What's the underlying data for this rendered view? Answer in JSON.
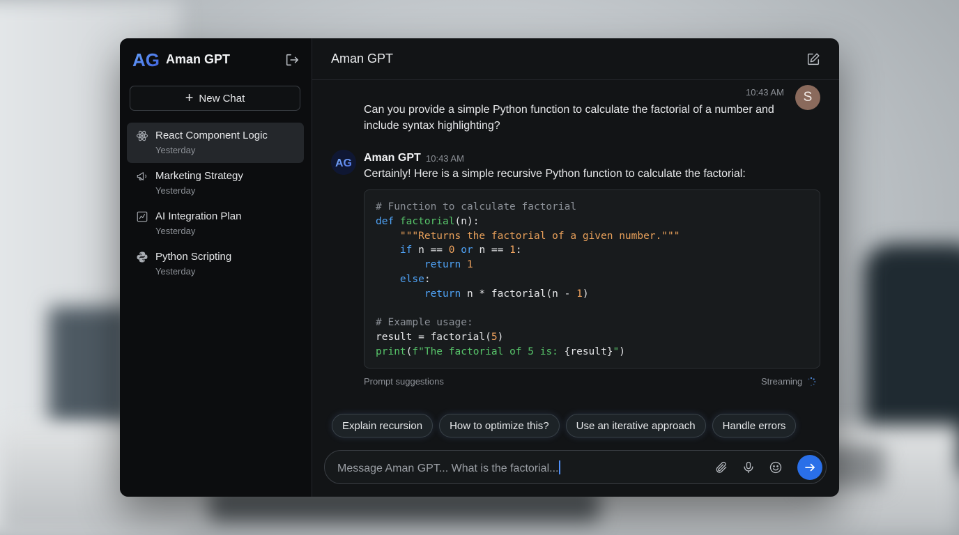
{
  "app": {
    "name": "Aman GPT",
    "logo_text": "AG",
    "accent": "#2a6fe8"
  },
  "sidebar": {
    "new_chat_label": "New Chat",
    "items": [
      {
        "title": "React Component Logic",
        "subtitle": "Yesterday",
        "icon": "atom-icon",
        "active": true
      },
      {
        "title": "Marketing Strategy",
        "subtitle": "Yesterday",
        "icon": "megaphone-icon",
        "active": false
      },
      {
        "title": "AI Integration Plan",
        "subtitle": "Yesterday",
        "icon": "chart-icon",
        "active": false
      },
      {
        "title": "Python Scripting",
        "subtitle": "Yesterday",
        "icon": "python-icon",
        "active": false
      }
    ]
  },
  "header": {
    "title": "Aman GPT"
  },
  "conversation": {
    "user": {
      "avatar_initial": "S",
      "time": "10:43 AM",
      "text": "Can you provide a simple Python function to calculate the factorial of a number and include syntax highlighting?"
    },
    "assistant": {
      "name": "Aman GPT",
      "time": "10:43 AM",
      "text": "Certainly! Here is a simple recursive Python function to calculate the factorial:",
      "code_lines": [
        [
          {
            "t": "# Function to calculate factorial",
            "c": "comment"
          }
        ],
        [
          {
            "t": "def ",
            "c": "kw"
          },
          {
            "t": "factorial",
            "c": "fn"
          },
          {
            "t": "(n):",
            "c": "plain"
          }
        ],
        [
          {
            "t": "    ",
            "c": "plain"
          },
          {
            "t": "\"\"\"Returns the factorial of a given number.\"\"\"",
            "c": "str"
          }
        ],
        [
          {
            "t": "    ",
            "c": "plain"
          },
          {
            "t": "if",
            "c": "kw"
          },
          {
            "t": " n == ",
            "c": "plain"
          },
          {
            "t": "0",
            "c": "num"
          },
          {
            "t": " ",
            "c": "plain"
          },
          {
            "t": "or",
            "c": "kw"
          },
          {
            "t": " n == ",
            "c": "plain"
          },
          {
            "t": "1",
            "c": "num"
          },
          {
            "t": ":",
            "c": "plain"
          }
        ],
        [
          {
            "t": "        ",
            "c": "plain"
          },
          {
            "t": "return",
            "c": "kw"
          },
          {
            "t": " ",
            "c": "plain"
          },
          {
            "t": "1",
            "c": "num"
          }
        ],
        [
          {
            "t": "    ",
            "c": "plain"
          },
          {
            "t": "else",
            "c": "kw"
          },
          {
            "t": ":",
            "c": "plain"
          }
        ],
        [
          {
            "t": "        ",
            "c": "plain"
          },
          {
            "t": "return",
            "c": "kw"
          },
          {
            "t": " n * factorial(n - ",
            "c": "plain"
          },
          {
            "t": "1",
            "c": "num"
          },
          {
            "t": ")",
            "c": "plain"
          }
        ],
        [
          {
            "t": "",
            "c": "plain"
          }
        ],
        [
          {
            "t": "# Example usage:",
            "c": "comment"
          }
        ],
        [
          {
            "t": "result = factorial(",
            "c": "plain"
          },
          {
            "t": "5",
            "c": "num"
          },
          {
            "t": ")",
            "c": "plain"
          }
        ],
        [
          {
            "t": "print",
            "c": "fn"
          },
          {
            "t": "(",
            "c": "plain"
          },
          {
            "t": "f\"The factorial of 5 is: ",
            "c": "fn"
          },
          {
            "t": "{result}",
            "c": "plain"
          },
          {
            "t": "\"",
            "c": "fn"
          },
          {
            "t": ")",
            "c": "plain"
          }
        ]
      ]
    }
  },
  "suggestions": {
    "label": "Prompt suggestions",
    "status": "Streaming",
    "chips": [
      "Explain recursion",
      "How to optimize this?",
      "Use an iterative approach",
      "Handle errors"
    ]
  },
  "composer": {
    "placeholder": "Message Aman GPT...",
    "value": "Message Aman GPT... What is the factorial..."
  }
}
